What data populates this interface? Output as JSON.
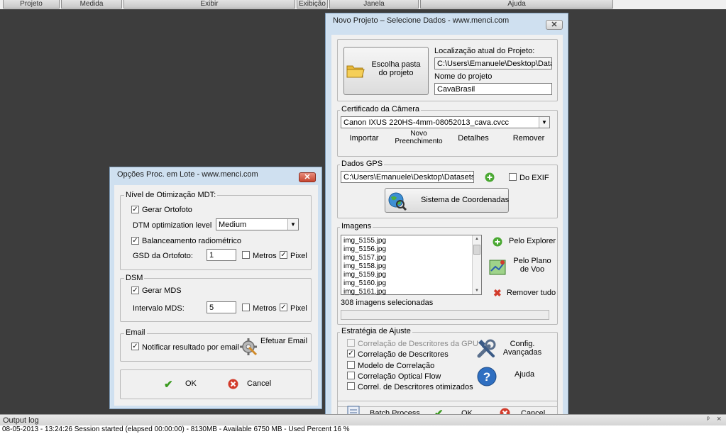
{
  "menubar": {
    "items": [
      "Projeto",
      "Medida",
      "Exibir",
      "Exibição",
      "Janela",
      "Ajuda"
    ]
  },
  "new_project": {
    "title": "Novo Projeto – Selecione Dados - www.menci.com",
    "choose_folder_label": "Escolha pasta do projeto",
    "location_label": "Localização atual do Projeto:",
    "location_value": "C:\\Users\\Emanuele\\Desktop\\Datasets\\C",
    "name_label": "Nome do projeto",
    "name_value": "CavaBrasil",
    "camera": {
      "title": "Certificado da Câmera",
      "selected": "Canon IXUS 220HS-4mm-08052013_cava.cvcc",
      "import_label": "Importar",
      "new_label": "Novo Preenchimento",
      "details_label": "Detalhes",
      "remove_label": "Remover"
    },
    "gps": {
      "title": "Dados GPS",
      "path_value": "C:\\Users\\Emanuele\\Desktop\\Datasets\\Cava",
      "exif_label": "Do EXIF",
      "coord_button": "Sistema de Coordenadas"
    },
    "images": {
      "title": "Imagens",
      "files": [
        "img_5155.jpg",
        "img_5156.jpg",
        "img_5157.jpg",
        "img_5158.jpg",
        "img_5159.jpg",
        "img_5160.jpg",
        "img_5161.jpg"
      ],
      "explorer_label": "Pelo Explorer",
      "flight_plan_label": "Pelo Plano de Voo",
      "remove_all_label": "Remover tudo",
      "selected_count": "308 imagens selecionadas"
    },
    "strategy": {
      "title": "Estratégia de Ajuste",
      "options": [
        {
          "label": "Correlação de Descritores da GPU",
          "checked": false,
          "enabled": false
        },
        {
          "label": "Correlação de Descritores",
          "checked": true,
          "enabled": true
        },
        {
          "label": "Modelo de Correlação",
          "checked": false,
          "enabled": true
        },
        {
          "label": "Correlação Optical Flow",
          "checked": false,
          "enabled": true
        },
        {
          "label": "Correl. de Descritores otimizados",
          "checked": false,
          "enabled": true
        }
      ],
      "advanced_label": "Config. Avançadas",
      "help_label": "Ajuda"
    },
    "footer": {
      "batch_label": "Batch Process",
      "ok_label": "OK",
      "cancel_label": "Cancel"
    }
  },
  "batch_options": {
    "title": "Opções Proc. em Lote - www.menci.com",
    "dtm_group": "Nível de Otimização MDT:",
    "gen_ortho_label": "Gerar Ortofoto",
    "gen_ortho_checked": true,
    "dtm_level_label": "DTM optimization level",
    "dtm_level_value": "Medium",
    "radiometric_label": "Balanceamento radiométrico",
    "radiometric_checked": true,
    "gsd_label": "GSD da Ortofoto:",
    "gsd_value": "1",
    "gsd_metros_label": "Metros",
    "gsd_metros_checked": false,
    "gsd_pixel_label": "Pixel",
    "gsd_pixel_checked": true,
    "dsm_group": "DSM",
    "gen_mds_label": "Gerar MDS",
    "gen_mds_checked": true,
    "mds_interval_label": "Intervalo MDS:",
    "mds_interval_value": "5",
    "mds_metros_label": "Metros",
    "mds_metros_checked": false,
    "mds_pixel_label": "Pixel",
    "mds_pixel_checked": true,
    "email_group": "Email",
    "notify_label": "Notificar resultado por email",
    "notify_checked": true,
    "send_email_label": "Efetuar Email",
    "ok_label": "OK",
    "cancel_label": "Cancel"
  },
  "output_log": {
    "title": "Output log",
    "line": "08-05-2013 - 13:24:26 Session started (elapsed 00:00:00) - 8130MB - Available 6750 MB - Used Percent 16 %"
  },
  "colors": {
    "workspace": "#3d3d3d",
    "window_frame": "#cfe0f0",
    "panel": "#f0f0f0",
    "ok_green": "#3a9a1e",
    "cancel_red": "#d23b2b"
  }
}
